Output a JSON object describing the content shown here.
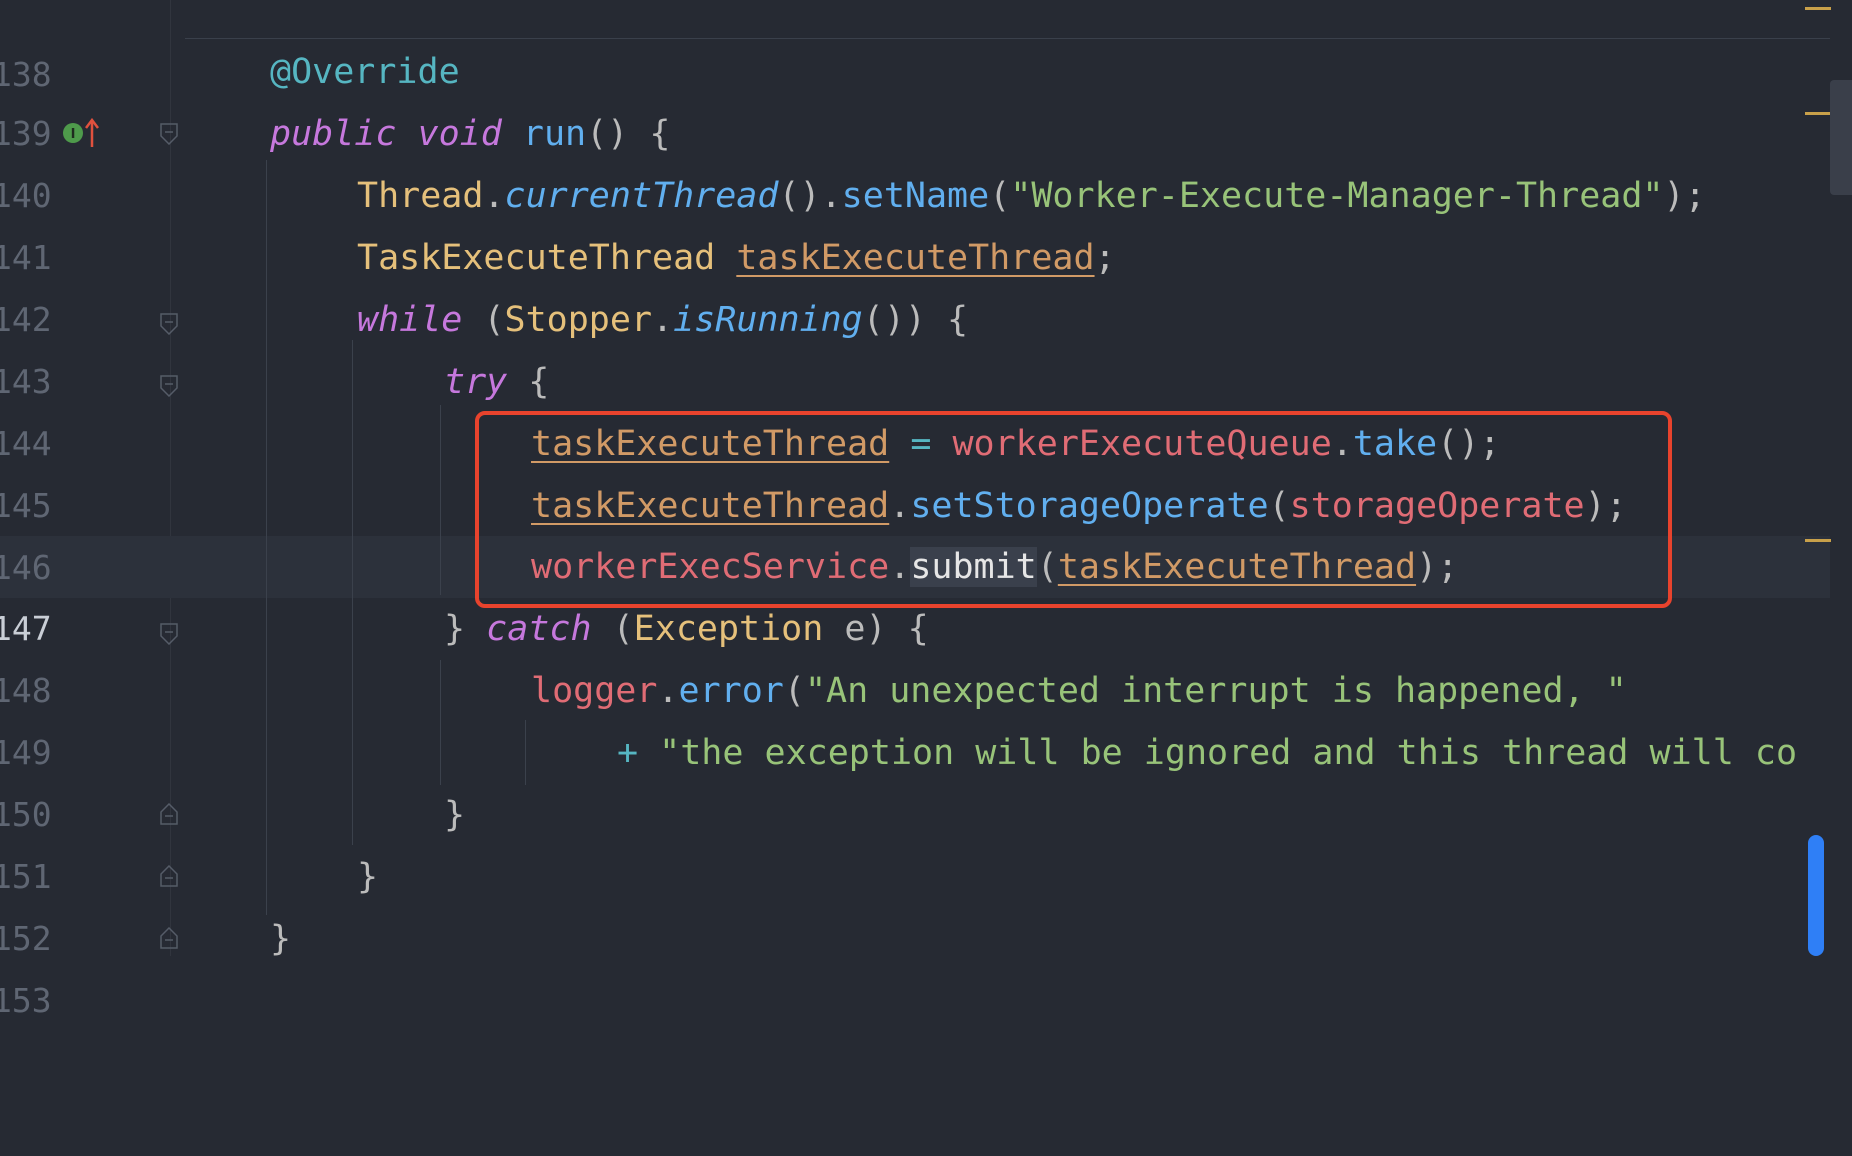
{
  "editor": {
    "language": "java",
    "current_line": "147",
    "lines": [
      {
        "num": "138",
        "text": ""
      },
      {
        "num": "139",
        "text": "@Override"
      },
      {
        "num": "140",
        "text": "public void run() {"
      },
      {
        "num": "141",
        "text": "Thread.currentThread().setName(\"Worker-Execute-Manager-Thread\");"
      },
      {
        "num": "142",
        "text": "TaskExecuteThread taskExecuteThread;"
      },
      {
        "num": "143",
        "text": "while (Stopper.isRunning()) {"
      },
      {
        "num": "144",
        "text": "try {"
      },
      {
        "num": "145",
        "text": "taskExecuteThread = workerExecuteQueue.take();"
      },
      {
        "num": "146",
        "text": "taskExecuteThread.setStorageOperate(storageOperate);"
      },
      {
        "num": "147",
        "text": "workerExecService.submit(taskExecuteThread);"
      },
      {
        "num": "148",
        "text": "} catch (Exception e) {"
      },
      {
        "num": "149",
        "text": "logger.error(\"An unexpected interrupt is happened, \""
      },
      {
        "num": "150",
        "text": "+ \"the exception will be ignored and this thread will co"
      },
      {
        "num": "151",
        "text": "}"
      },
      {
        "num": "152",
        "text": "}"
      },
      {
        "num": "153",
        "text": "}"
      }
    ],
    "tokens": {
      "override": "@Override",
      "public": "public",
      "void": "void",
      "run": "run",
      "thread": "Thread",
      "current_thread": "currentThread",
      "set_name": "setName",
      "thread_name_str": "\"Worker-Execute-Manager-Thread\"",
      "task_execute_thread_cls": "TaskExecuteThread",
      "task_execute_thread": "taskExecuteThread",
      "while": "while",
      "stopper": "Stopper",
      "is_running": "isRunning",
      "try": "try",
      "worker_execute_queue": "workerExecuteQueue",
      "take": "take",
      "set_storage_operate": "setStorageOperate",
      "storage_operate": "storageOperate",
      "worker_exec_service": "workerExecService",
      "submit": "submit",
      "catch": "catch",
      "exception": "Exception",
      "e": "e",
      "logger": "logger",
      "error": "error",
      "msg1": "\"An unexpected interrupt is happened, \"",
      "plus": "+",
      "msg2": "\"the exception will be ignored and this thread will co"
    }
  },
  "gutter": {
    "implements_icon": "implements-method-icon",
    "override_arrow_icon": "arrow-up-icon"
  },
  "colors": {
    "background": "#262a33",
    "highlight_box": "#e8432d",
    "scrollbar": "#2f7ff6"
  }
}
